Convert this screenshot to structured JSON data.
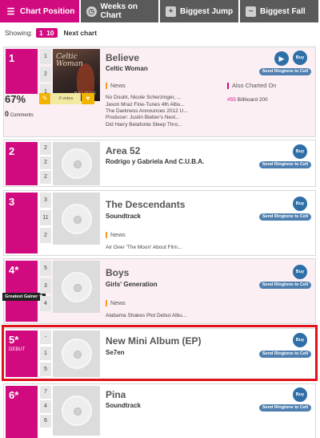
{
  "tabs": [
    {
      "label": "Chart Position",
      "icon": "list-icon",
      "active": true
    },
    {
      "label": "Weeks on Chart",
      "icon": "clock-icon",
      "active": false
    },
    {
      "label": "Biggest Jump",
      "icon": "plus-icon",
      "active": false
    },
    {
      "label": "Biggest Fall",
      "icon": "minus-icon",
      "active": false
    }
  ],
  "showing": {
    "label": "Showing:",
    "range_start": "1",
    "range_end": "10",
    "next": "Next chart"
  },
  "common": {
    "buy": "Buy",
    "ringtone": "Send Ringtone to Cell",
    "news": "News"
  },
  "rows": [
    {
      "rank": "1",
      "stats": [
        "1",
        "2",
        "1"
      ],
      "title": "Believe",
      "artist": "Celtic Woman",
      "cover_title": "Celtic Woman",
      "cover_sub": "BELIEVE",
      "news": [
        "No Doubt, Nicole Scherzinger, ...",
        "Jason Mraz Fine-Tunes 4th Albu...",
        "The Darkness Announces 2012 U...",
        "Producer: Justin Bieber's Next...",
        "Did Harry Belafonte Sleep Thro..."
      ],
      "also_label": "Also Charted On",
      "also_rank": "#55",
      "also_chart": "Billboard 200",
      "percent": "67%",
      "comments_count": "0",
      "comments_label": "Comments",
      "votes": "0 votes"
    },
    {
      "rank": "2",
      "stats": [
        "2",
        "2",
        "2"
      ],
      "title": "Area 52",
      "artist": "Rodrigo y Gabriela And C.U.B.A."
    },
    {
      "rank": "3",
      "stats": [
        "3",
        "11",
        "2"
      ],
      "title": "The Descendants",
      "artist": "Soundtrack",
      "news": [
        "Air Over 'The Moon' About Film..."
      ]
    },
    {
      "rank": "4*",
      "stats": [
        "5",
        "3",
        "4"
      ],
      "title": "Boys",
      "artist": "Girls' Generation",
      "badge": "Greatest Gainer",
      "news": [
        "Alabama Shakes Plot Debut Albu..."
      ]
    },
    {
      "rank": "5*",
      "sub": "DEBUT",
      "stats": [
        "-",
        "1",
        "5"
      ],
      "title": "New Mini Album (EP)",
      "artist": "Se7en"
    },
    {
      "rank": "6*",
      "stats": [
        "7",
        "4",
        "6"
      ],
      "title": "Pina",
      "artist": "Soundtrack"
    }
  ],
  "colors": {
    "accent": "#d10a80",
    "tab_inactive": "#5a5a5a",
    "highlight": "#e0121b",
    "button": "#2f6fa8"
  }
}
